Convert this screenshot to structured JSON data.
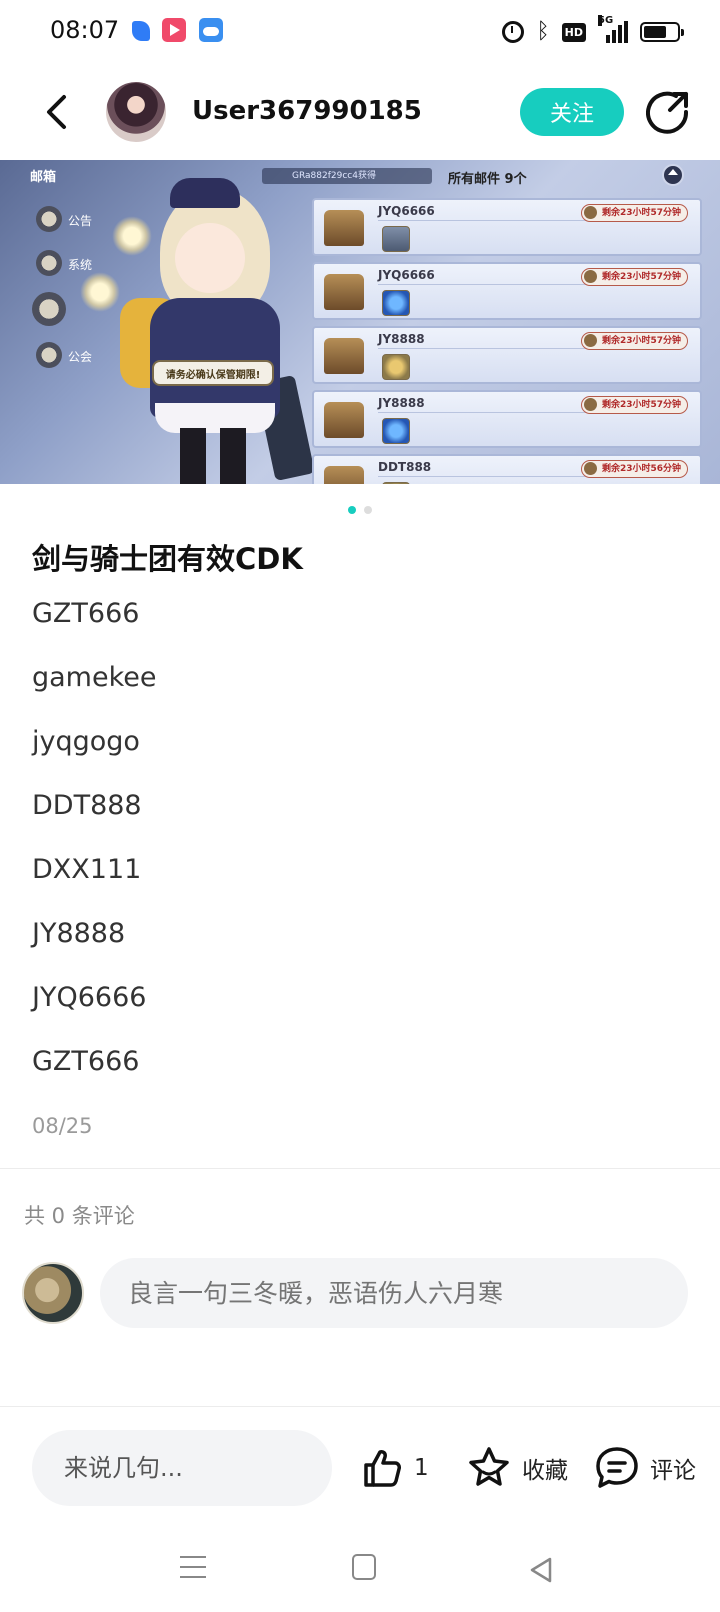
{
  "status_bar": {
    "time": "08:07",
    "hd_label": "HD",
    "network_label": "5G",
    "battery_level": 0.7
  },
  "header": {
    "username": "User367990185",
    "follow_label": "关注"
  },
  "banner": {
    "page_count": 2,
    "active_index": 0,
    "game": {
      "back_label": "邮箱",
      "sidebar": [
        "公告",
        "系统",
        "公会"
      ],
      "ticker": "GRa882f29cc4获得",
      "mail_count": "所有邮件 9个",
      "speech": "请务必确认保管期限!",
      "mails": [
        {
          "sender": "JYQ6666",
          "timer": "剩余23小时57分钟",
          "reward": "grey"
        },
        {
          "sender": "JYQ6666",
          "timer": "剩余23小时57分钟",
          "reward": "blue"
        },
        {
          "sender": "JY8888",
          "timer": "剩余23小时57分钟",
          "reward": "gold"
        },
        {
          "sender": "JY8888",
          "timer": "剩余23小时57分钟",
          "reward": "blue"
        },
        {
          "sender": "DDT888",
          "timer": "剩余23小时56分钟",
          "reward": "gold"
        }
      ]
    }
  },
  "post": {
    "title": "剑与骑士团有效CDK",
    "codes": [
      "GZT666",
      "gamekee",
      "jyqgogo",
      "DDT888",
      "DXX111",
      "JY8888",
      "JYQ6666",
      "GZT666"
    ],
    "date": "08/25"
  },
  "comments": {
    "count_label": "共 0 条评论",
    "input_placeholder": "良言一句三冬暖，恶语伤人六月寒"
  },
  "action_bar": {
    "quick_input": "来说几句...",
    "like_count": "1",
    "favorite_label": "收藏",
    "comment_label": "评论"
  },
  "colors": {
    "accent": "#17cdbf"
  }
}
